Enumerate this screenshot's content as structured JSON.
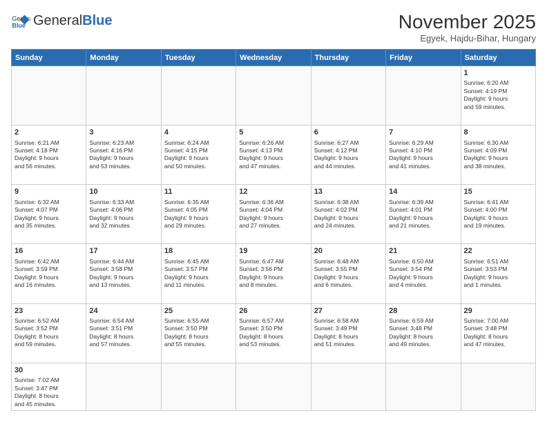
{
  "logo": {
    "text_general": "General",
    "text_blue": "Blue"
  },
  "title": "November 2025",
  "location": "Egyek, Hajdu-Bihar, Hungary",
  "weekdays": [
    "Sunday",
    "Monday",
    "Tuesday",
    "Wednesday",
    "Thursday",
    "Friday",
    "Saturday"
  ],
  "weeks": [
    [
      null,
      null,
      null,
      null,
      null,
      null,
      {
        "day": 1,
        "sunrise": "6:20 AM",
        "sunset": "4:19 PM",
        "daylight_hours": 9,
        "daylight_minutes": 59
      }
    ],
    [
      {
        "day": 2,
        "sunrise": "6:21 AM",
        "sunset": "4:18 PM",
        "daylight_hours": 9,
        "daylight_minutes": 56
      },
      {
        "day": 3,
        "sunrise": "6:23 AM",
        "sunset": "4:16 PM",
        "daylight_hours": 9,
        "daylight_minutes": 53
      },
      {
        "day": 4,
        "sunrise": "6:24 AM",
        "sunset": "4:15 PM",
        "daylight_hours": 9,
        "daylight_minutes": 50
      },
      {
        "day": 5,
        "sunrise": "6:26 AM",
        "sunset": "4:13 PM",
        "daylight_hours": 9,
        "daylight_minutes": 47
      },
      {
        "day": 6,
        "sunrise": "6:27 AM",
        "sunset": "4:12 PM",
        "daylight_hours": 9,
        "daylight_minutes": 44
      },
      {
        "day": 7,
        "sunrise": "6:29 AM",
        "sunset": "4:10 PM",
        "daylight_hours": 9,
        "daylight_minutes": 41
      },
      {
        "day": 8,
        "sunrise": "6:30 AM",
        "sunset": "4:09 PM",
        "daylight_hours": 9,
        "daylight_minutes": 38
      }
    ],
    [
      {
        "day": 9,
        "sunrise": "6:32 AM",
        "sunset": "4:07 PM",
        "daylight_hours": 9,
        "daylight_minutes": 35
      },
      {
        "day": 10,
        "sunrise": "6:33 AM",
        "sunset": "4:06 PM",
        "daylight_hours": 9,
        "daylight_minutes": 32
      },
      {
        "day": 11,
        "sunrise": "6:35 AM",
        "sunset": "4:05 PM",
        "daylight_hours": 9,
        "daylight_minutes": 29
      },
      {
        "day": 12,
        "sunrise": "6:36 AM",
        "sunset": "4:04 PM",
        "daylight_hours": 9,
        "daylight_minutes": 27
      },
      {
        "day": 13,
        "sunrise": "6:38 AM",
        "sunset": "4:02 PM",
        "daylight_hours": 9,
        "daylight_minutes": 24
      },
      {
        "day": 14,
        "sunrise": "6:39 AM",
        "sunset": "4:01 PM",
        "daylight_hours": 9,
        "daylight_minutes": 21
      },
      {
        "day": 15,
        "sunrise": "6:41 AM",
        "sunset": "4:00 PM",
        "daylight_hours": 9,
        "daylight_minutes": 19
      }
    ],
    [
      {
        "day": 16,
        "sunrise": "6:42 AM",
        "sunset": "3:59 PM",
        "daylight_hours": 9,
        "daylight_minutes": 16
      },
      {
        "day": 17,
        "sunrise": "6:44 AM",
        "sunset": "3:58 PM",
        "daylight_hours": 9,
        "daylight_minutes": 13
      },
      {
        "day": 18,
        "sunrise": "6:45 AM",
        "sunset": "3:57 PM",
        "daylight_hours": 9,
        "daylight_minutes": 11
      },
      {
        "day": 19,
        "sunrise": "6:47 AM",
        "sunset": "3:56 PM",
        "daylight_hours": 9,
        "daylight_minutes": 8
      },
      {
        "day": 20,
        "sunrise": "6:48 AM",
        "sunset": "3:55 PM",
        "daylight_hours": 9,
        "daylight_minutes": 6
      },
      {
        "day": 21,
        "sunrise": "6:50 AM",
        "sunset": "3:54 PM",
        "daylight_hours": 9,
        "daylight_minutes": 4
      },
      {
        "day": 22,
        "sunrise": "6:51 AM",
        "sunset": "3:53 PM",
        "daylight_hours": 9,
        "daylight_minutes": 1
      }
    ],
    [
      {
        "day": 23,
        "sunrise": "6:52 AM",
        "sunset": "3:52 PM",
        "daylight_hours": 8,
        "daylight_minutes": 59
      },
      {
        "day": 24,
        "sunrise": "6:54 AM",
        "sunset": "3:51 PM",
        "daylight_hours": 8,
        "daylight_minutes": 57
      },
      {
        "day": 25,
        "sunrise": "6:55 AM",
        "sunset": "3:50 PM",
        "daylight_hours": 8,
        "daylight_minutes": 55
      },
      {
        "day": 26,
        "sunrise": "6:57 AM",
        "sunset": "3:50 PM",
        "daylight_hours": 8,
        "daylight_minutes": 53
      },
      {
        "day": 27,
        "sunrise": "6:58 AM",
        "sunset": "3:49 PM",
        "daylight_hours": 8,
        "daylight_minutes": 51
      },
      {
        "day": 28,
        "sunrise": "6:59 AM",
        "sunset": "3:48 PM",
        "daylight_hours": 8,
        "daylight_minutes": 49
      },
      {
        "day": 29,
        "sunrise": "7:00 AM",
        "sunset": "3:48 PM",
        "daylight_hours": 8,
        "daylight_minutes": 47
      }
    ],
    [
      {
        "day": 30,
        "sunrise": "7:02 AM",
        "sunset": "3:47 PM",
        "daylight_hours": 8,
        "daylight_minutes": 45
      },
      null,
      null,
      null,
      null,
      null,
      null
    ]
  ]
}
